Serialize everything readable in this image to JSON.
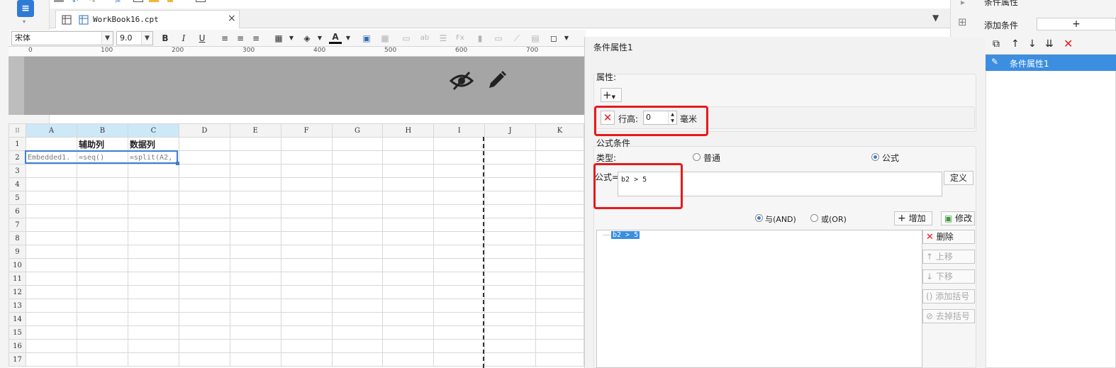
{
  "app": {
    "logo_icon": "report-designer-logo-icon"
  },
  "tab": {
    "name": "WorkBook16.cpt",
    "close": "×"
  },
  "format_bar": {
    "font_family": "宋体",
    "font_size": "9.0",
    "bold": "B",
    "italic": "I",
    "underline": "U"
  },
  "ruler": {
    "marks": [
      "0",
      "100",
      "200",
      "300",
      "400",
      "500",
      "600",
      "700"
    ]
  },
  "sheet": {
    "columns": [
      "A",
      "B",
      "C",
      "D",
      "E",
      "F",
      "G",
      "H",
      "I",
      "J",
      "K"
    ],
    "rows": [
      {
        "num": "1",
        "cells": [
          "",
          "辅助列",
          "数据列",
          "",
          "",
          "",
          "",
          "",
          "",
          "",
          ""
        ]
      },
      {
        "num": "2",
        "cells": [
          "Embedded1.",
          "=seq()",
          "=split(A2,",
          "",
          "",
          "",
          "",
          "",
          "",
          "",
          ""
        ]
      },
      {
        "num": "3",
        "cells": [
          "",
          "",
          "",
          "",
          "",
          "",
          "",
          "",
          "",
          "",
          ""
        ]
      },
      {
        "num": "4",
        "cells": [
          "",
          "",
          "",
          "",
          "",
          "",
          "",
          "",
          "",
          "",
          ""
        ]
      },
      {
        "num": "5",
        "cells": [
          "",
          "",
          "",
          "",
          "",
          "",
          "",
          "",
          "",
          "",
          ""
        ]
      },
      {
        "num": "6",
        "cells": [
          "",
          "",
          "",
          "",
          "",
          "",
          "",
          "",
          "",
          "",
          ""
        ]
      },
      {
        "num": "7",
        "cells": [
          "",
          "",
          "",
          "",
          "",
          "",
          "",
          "",
          "",
          "",
          ""
        ]
      },
      {
        "num": "8",
        "cells": [
          "",
          "",
          "",
          "",
          "",
          "",
          "",
          "",
          "",
          "",
          ""
        ]
      },
      {
        "num": "9",
        "cells": [
          "",
          "",
          "",
          "",
          "",
          "",
          "",
          "",
          "",
          "",
          ""
        ]
      },
      {
        "num": "10",
        "cells": [
          "",
          "",
          "",
          "",
          "",
          "",
          "",
          "",
          "",
          "",
          ""
        ]
      },
      {
        "num": "11",
        "cells": [
          "",
          "",
          "",
          "",
          "",
          "",
          "",
          "",
          "",
          "",
          ""
        ]
      },
      {
        "num": "12",
        "cells": [
          "",
          "",
          "",
          "",
          "",
          "",
          "",
          "",
          "",
          "",
          ""
        ]
      },
      {
        "num": "13",
        "cells": [
          "",
          "",
          "",
          "",
          "",
          "",
          "",
          "",
          "",
          "",
          ""
        ]
      },
      {
        "num": "14",
        "cells": [
          "",
          "",
          "",
          "",
          "",
          "",
          "",
          "",
          "",
          "",
          ""
        ]
      },
      {
        "num": "15",
        "cells": [
          "",
          "",
          "",
          "",
          "",
          "",
          "",
          "",
          "",
          "",
          ""
        ]
      },
      {
        "num": "16",
        "cells": [
          "",
          "",
          "",
          "",
          "",
          "",
          "",
          "",
          "",
          "",
          ""
        ]
      },
      {
        "num": "17",
        "cells": [
          "",
          "",
          "",
          "",
          "",
          "",
          "",
          "",
          "",
          "",
          ""
        ]
      }
    ]
  },
  "dialog": {
    "title": "条件属性1",
    "properties_label": "属性:",
    "add_symbol": "+",
    "row_height_label": "行高:",
    "row_height_value": "0",
    "row_height_unit": "毫米",
    "formula_condition_label": "公式条件",
    "type_label": "类型:",
    "type_normal": "普通",
    "type_formula": "公式",
    "type_selected": "公式",
    "formula_label": "公式=",
    "formula_value": "b2 > 5",
    "define_button": "定义",
    "and_label": "与(AND)",
    "or_label": "或(OR)",
    "logic_selected": "与(AND)",
    "add_button": "增加",
    "modify_button": "修改",
    "delete_button": "删除",
    "move_up_button": "上移",
    "move_down_button": "下移",
    "add_bracket_button": "添加括号",
    "remove_bracket_button": "去掉括号",
    "conditions": [
      "b2 > 5"
    ]
  },
  "right_panel": {
    "header": "条件属性",
    "add_condition_label": "添加条件",
    "add_symbol": "+",
    "items": [
      "条件属性1"
    ]
  },
  "colors": {
    "accent": "#3b7fd1",
    "highlight_red": "#e8191c",
    "band_gray": "#a5a5a5",
    "selection_item": "#3b8ee0"
  }
}
